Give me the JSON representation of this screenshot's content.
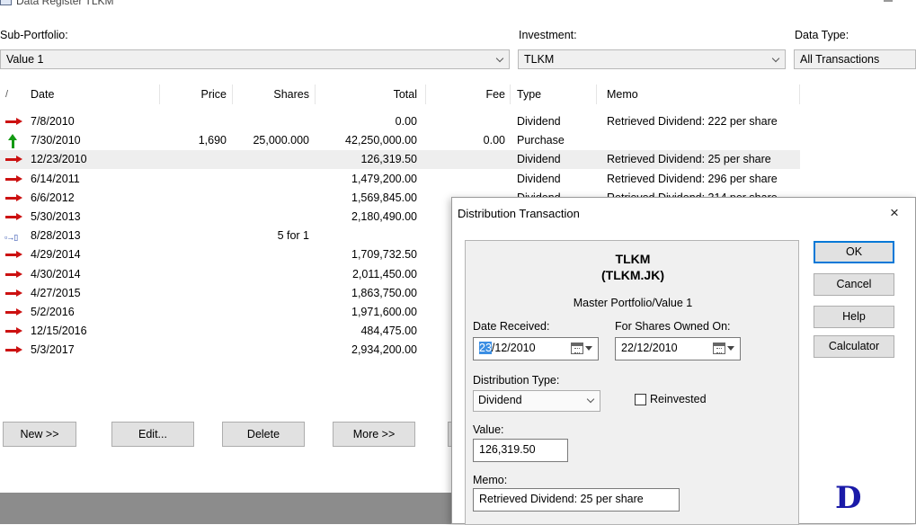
{
  "window": {
    "title": "Data Register TLKM"
  },
  "filters": {
    "sub_portfolio": {
      "label": "Sub-Portfolio:",
      "value": "Value 1"
    },
    "investment": {
      "label": "Investment:",
      "value": "TLKM"
    },
    "data_type": {
      "label": "Data Type:",
      "value": "All Transactions"
    }
  },
  "grid": {
    "sort_marker": "/",
    "columns": {
      "date": "Date",
      "price": "Price",
      "shares": "Shares",
      "total": "Total",
      "fee": "Fee",
      "type": "Type",
      "memo": "Memo"
    },
    "rows": [
      {
        "icon": "red-arrow-icon",
        "date": "7/8/2010",
        "price": "",
        "shares": "",
        "total": "0.00",
        "fee": "",
        "type": "Dividend",
        "memo": "Retrieved Dividend: 222 per share"
      },
      {
        "icon": "green-up-arrow-icon",
        "date": "7/30/2010",
        "price": "1,690",
        "shares": "25,000.000",
        "total": "42,250,000.00",
        "fee": "0.00",
        "type": "Purchase",
        "memo": ""
      },
      {
        "icon": "red-arrow-icon",
        "date": "12/23/2010",
        "price": "",
        "shares": "",
        "total": "126,319.50",
        "fee": "",
        "type": "Dividend",
        "memo": "Retrieved Dividend: 25 per share",
        "selected": true
      },
      {
        "icon": "red-arrow-icon",
        "date": "6/14/2011",
        "price": "",
        "shares": "",
        "total": "1,479,200.00",
        "fee": "",
        "type": "Dividend",
        "memo": "Retrieved Dividend: 296 per share"
      },
      {
        "icon": "red-arrow-icon",
        "date": "6/6/2012",
        "price": "",
        "shares": "",
        "total": "1,569,845.00",
        "fee": "",
        "type": "Dividend",
        "memo": "Retrieved Dividend: 314 per share"
      },
      {
        "icon": "red-arrow-icon",
        "date": "5/30/2013",
        "price": "",
        "shares": "",
        "total": "2,180,490.00",
        "fee": "",
        "type": "",
        "memo": ""
      },
      {
        "icon": "split-icon",
        "date": "8/28/2013",
        "price": "",
        "shares": "5 for 1",
        "total": "",
        "fee": "",
        "type": "",
        "memo": ""
      },
      {
        "icon": "red-arrow-icon",
        "date": "4/29/2014",
        "price": "",
        "shares": "",
        "total": "1,709,732.50",
        "fee": "",
        "type": "",
        "memo": ""
      },
      {
        "icon": "red-arrow-icon",
        "date": "4/30/2014",
        "price": "",
        "shares": "",
        "total": "2,011,450.00",
        "fee": "",
        "type": "",
        "memo": ""
      },
      {
        "icon": "red-arrow-icon",
        "date": "4/27/2015",
        "price": "",
        "shares": "",
        "total": "1,863,750.00",
        "fee": "",
        "type": "",
        "memo": ""
      },
      {
        "icon": "red-arrow-icon",
        "date": "5/2/2016",
        "price": "",
        "shares": "",
        "total": "1,971,600.00",
        "fee": "",
        "type": "",
        "memo": ""
      },
      {
        "icon": "red-arrow-icon",
        "date": "12/15/2016",
        "price": "",
        "shares": "",
        "total": "484,475.00",
        "fee": "",
        "type": "",
        "memo": ""
      },
      {
        "icon": "red-arrow-icon",
        "date": "5/3/2017",
        "price": "",
        "shares": "",
        "total": "2,934,200.00",
        "fee": "",
        "type": "",
        "memo": ""
      }
    ]
  },
  "buttons": {
    "new": "New >>",
    "edit": "Edit...",
    "delete": "Delete",
    "more": "More >>"
  },
  "dialog": {
    "title": "Distribution Transaction",
    "close": "×",
    "ticker": "TLKM",
    "ticker_full": "(TLKM.JK)",
    "portfolio": "Master Portfolio/Value 1",
    "date_received_label": "Date Received:",
    "date_received_day": "23",
    "date_received_rest": "/12/2010",
    "shares_owned_on_label": "For Shares Owned On:",
    "shares_owned_on_value": "22/12/2010",
    "distribution_type_label": "Distribution Type:",
    "distribution_type_value": "Dividend",
    "reinvested_label": "Reinvested",
    "value_label": "Value:",
    "value": "126,319.50",
    "memo_label": "Memo:",
    "memo": "Retrieved Dividend: 25 per share",
    "ok": "OK",
    "cancel": "Cancel",
    "help": "Help",
    "calculator": "Calculator",
    "logo": "D"
  }
}
